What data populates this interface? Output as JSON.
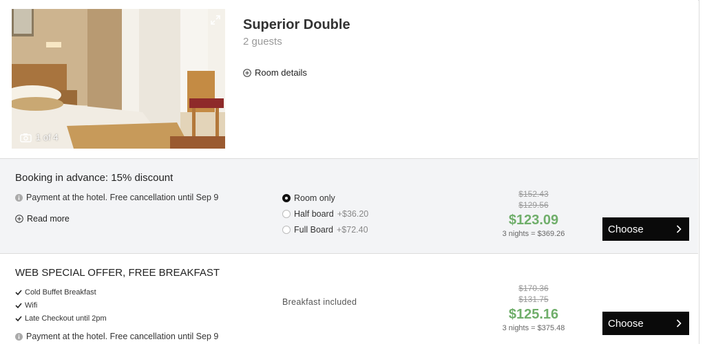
{
  "room": {
    "title": "Superior Double",
    "guests": "2 guests",
    "details_label": "Room details",
    "photo_counter": "1 of 4"
  },
  "offers": [
    {
      "title": "Booking in advance: 15% discount",
      "payment_info": "Payment at the hotel. Free cancellation until Sep 9",
      "read_more": "Read more",
      "board_options": [
        {
          "label": "Room only",
          "extra": "",
          "selected": true
        },
        {
          "label": "Half board",
          "extra": "+$36.20",
          "selected": false
        },
        {
          "label": "Full Board",
          "extra": "+$72.40",
          "selected": false
        }
      ],
      "old_prices": [
        "$152.43",
        "$129.56"
      ],
      "price": "$123.09",
      "nights_total": "3 nights = $369.26",
      "button": "Choose"
    },
    {
      "title": "WEB SPECIAL OFFER, FREE BREAKFAST",
      "features": [
        "Cold Buffet Breakfast",
        "Wifi",
        "Late Checkout until 2pm"
      ],
      "payment_info": "Payment at the hotel. Free cancellation until Sep 9",
      "board_note": "Breakfast included",
      "old_prices": [
        "$170.36",
        "$131.75"
      ],
      "price": "$125.16",
      "nights_total": "3 nights = $375.48",
      "button": "Choose"
    }
  ],
  "colors": {
    "price_green": "#6fae6a",
    "button_bg": "#0a0a0a",
    "row_bg": "#f3f4f6"
  },
  "icons": {
    "expand": "expand-icon",
    "camera": "camera-icon",
    "plus": "plus-circle-icon",
    "info": "info-icon",
    "check": "check-icon",
    "chevron": "chevron-right-icon"
  }
}
